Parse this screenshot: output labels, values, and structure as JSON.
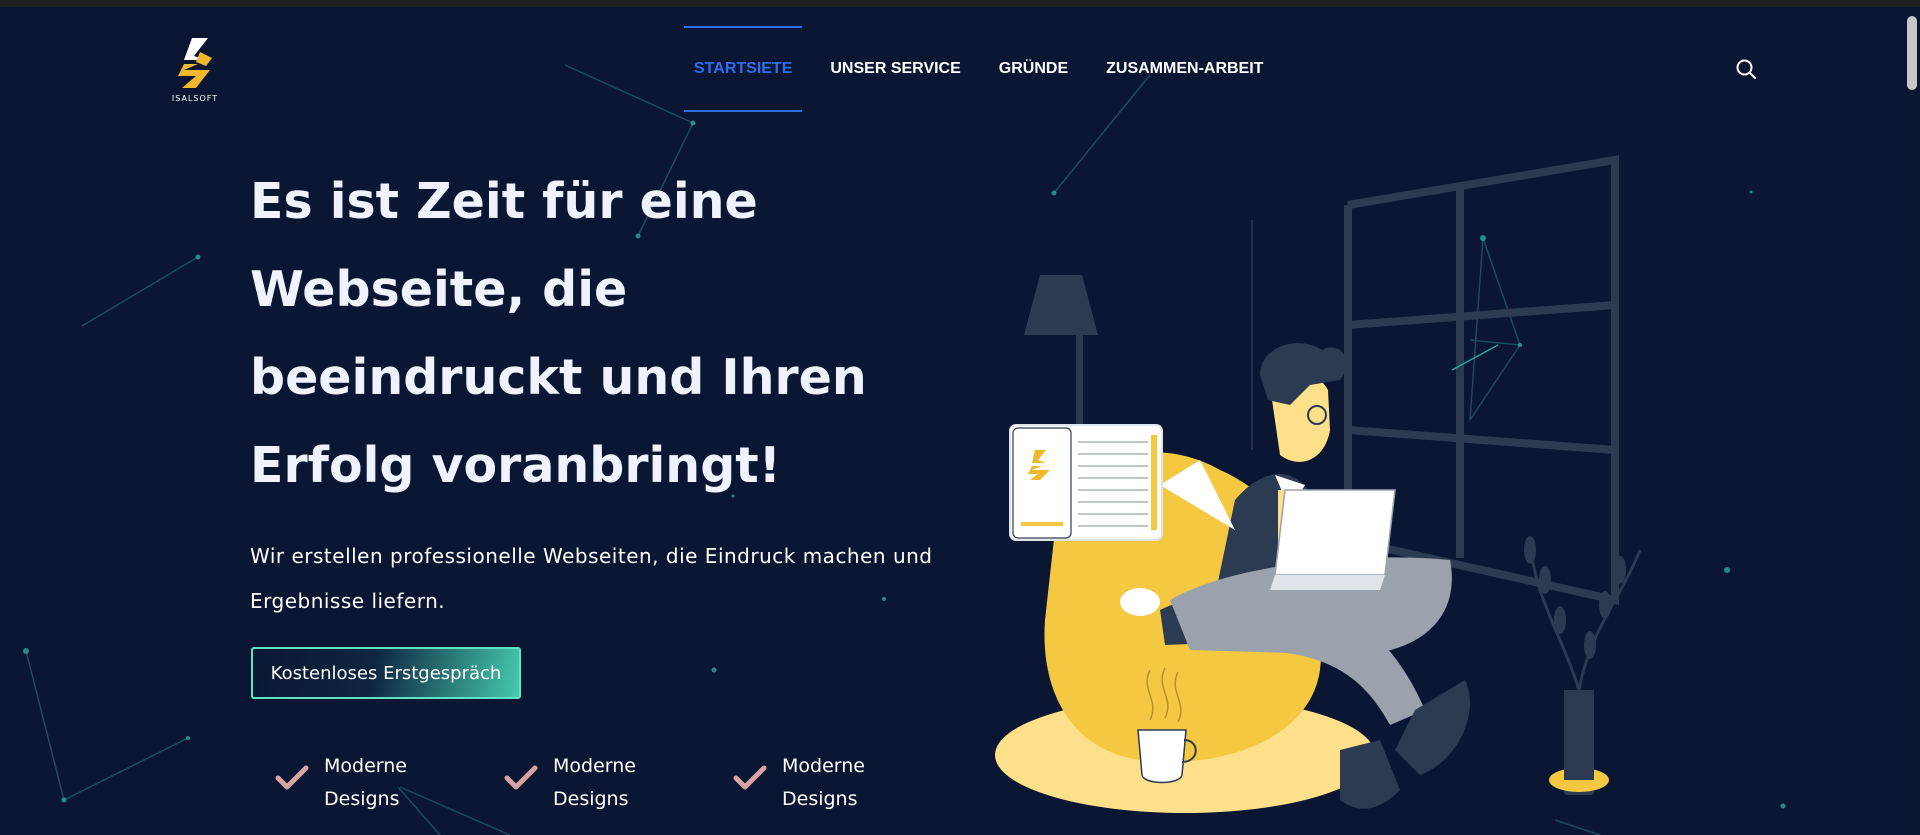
{
  "brand": {
    "logo_text": "ISALSOFT"
  },
  "nav": {
    "items": [
      {
        "label": "STARTSIETE",
        "active": true
      },
      {
        "label": "UNSER SERVICE",
        "active": false
      },
      {
        "label": "GRÜNDE",
        "active": false
      },
      {
        "label": "ZUSAMMEN-ARBEIT",
        "active": false
      }
    ],
    "search_icon": "search-icon"
  },
  "hero": {
    "title": "Es ist Zeit für eine Webseite, die beeindruckt und Ihren Erfolg voranbringt!",
    "subtitle": "Wir erstellen professionelle Webseiten, die Eindruck machen und Ergebnisse liefern.",
    "cta_label": "Kostenloses Erstgespräch"
  },
  "features": [
    {
      "icon": "check-icon",
      "label": "Moderne Designs"
    },
    {
      "icon": "check-icon",
      "label": "Moderne Designs"
    },
    {
      "icon": "check-icon",
      "label": "Moderne Designs"
    }
  ],
  "colors": {
    "background": "#0b1732",
    "accent_blue": "#2e6cf0",
    "accent_teal": "#5fe3c6",
    "accent_yellow": "#f5c842",
    "check_pink": "#d9a3a3"
  }
}
